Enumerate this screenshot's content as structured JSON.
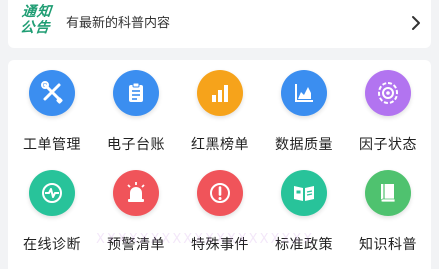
{
  "notice": {
    "badge_line1": "通知",
    "badge_line2": "公告",
    "text": "有最新的科普内容"
  },
  "colors": {
    "blue": "#3b8ef0",
    "orange": "#f6a31b",
    "purple": "#b274f0",
    "teal": "#28c39a",
    "red": "#f0545a",
    "green": "#4fc26f",
    "badge": "#1f9d73"
  },
  "grid": {
    "items": [
      {
        "label": "工单管理",
        "icon": "tools-icon"
      },
      {
        "label": "电子台账",
        "icon": "clipboard-icon"
      },
      {
        "label": "红黑榜单",
        "icon": "bar-chart-icon"
      },
      {
        "label": "数据质量",
        "icon": "area-chart-icon"
      },
      {
        "label": "因子状态",
        "icon": "factor-icon"
      },
      {
        "label": "在线诊断",
        "icon": "heartbeat-icon"
      },
      {
        "label": "预警清单",
        "icon": "alarm-light-icon"
      },
      {
        "label": "特殊事件",
        "icon": "exclamation-icon"
      },
      {
        "label": "标准政策",
        "icon": "book-open-icon"
      },
      {
        "label": "知识科普",
        "icon": "book-icon"
      }
    ]
  },
  "watermark": "XXXXXXXXXXXXXXXXXXXX"
}
